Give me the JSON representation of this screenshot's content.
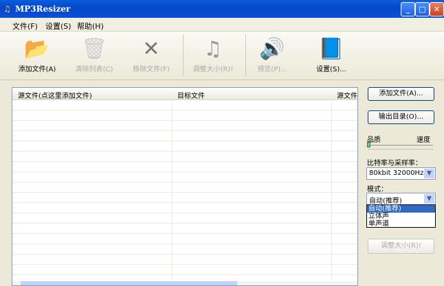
{
  "window": {
    "title": "MP3Resizer"
  },
  "menu": [
    "文件(F)",
    "设置(S)",
    "帮助(H)"
  ],
  "toolbar": [
    {
      "label": "添加文件(A)",
      "icon": "folder-music-icon",
      "enabled": true
    },
    {
      "label": "清除列表(C)",
      "icon": "recycle-bin-icon",
      "enabled": false
    },
    {
      "label": "移除文件(F)",
      "icon": "x-icon",
      "enabled": false
    },
    {
      "label": "调整大小(R)!",
      "icon": "music-note-icon",
      "enabled": false
    },
    {
      "label": "预览(P)...",
      "icon": "speaker-icon",
      "enabled": false
    },
    {
      "label": "设置(S)...",
      "icon": "settings-book-icon",
      "enabled": true
    }
  ],
  "table": {
    "columns": [
      "源文件(点这里添加文件)",
      "目标文件",
      "源文件"
    ]
  },
  "panel": {
    "add_files": "添加文件(A)...",
    "output_dir": "输出目录(O)...",
    "quality": "品质",
    "speed": "速度",
    "slider_value": 0,
    "bitrate_label": "比特率与采样率：",
    "bitrate_value": "80kbit 32000Hz",
    "mode_label": "模式：",
    "mode_value": "自动(推荐)",
    "mode_options": [
      "自动(推荐)",
      "立体声",
      "单声道"
    ],
    "resize": "调整大小(R)!"
  }
}
